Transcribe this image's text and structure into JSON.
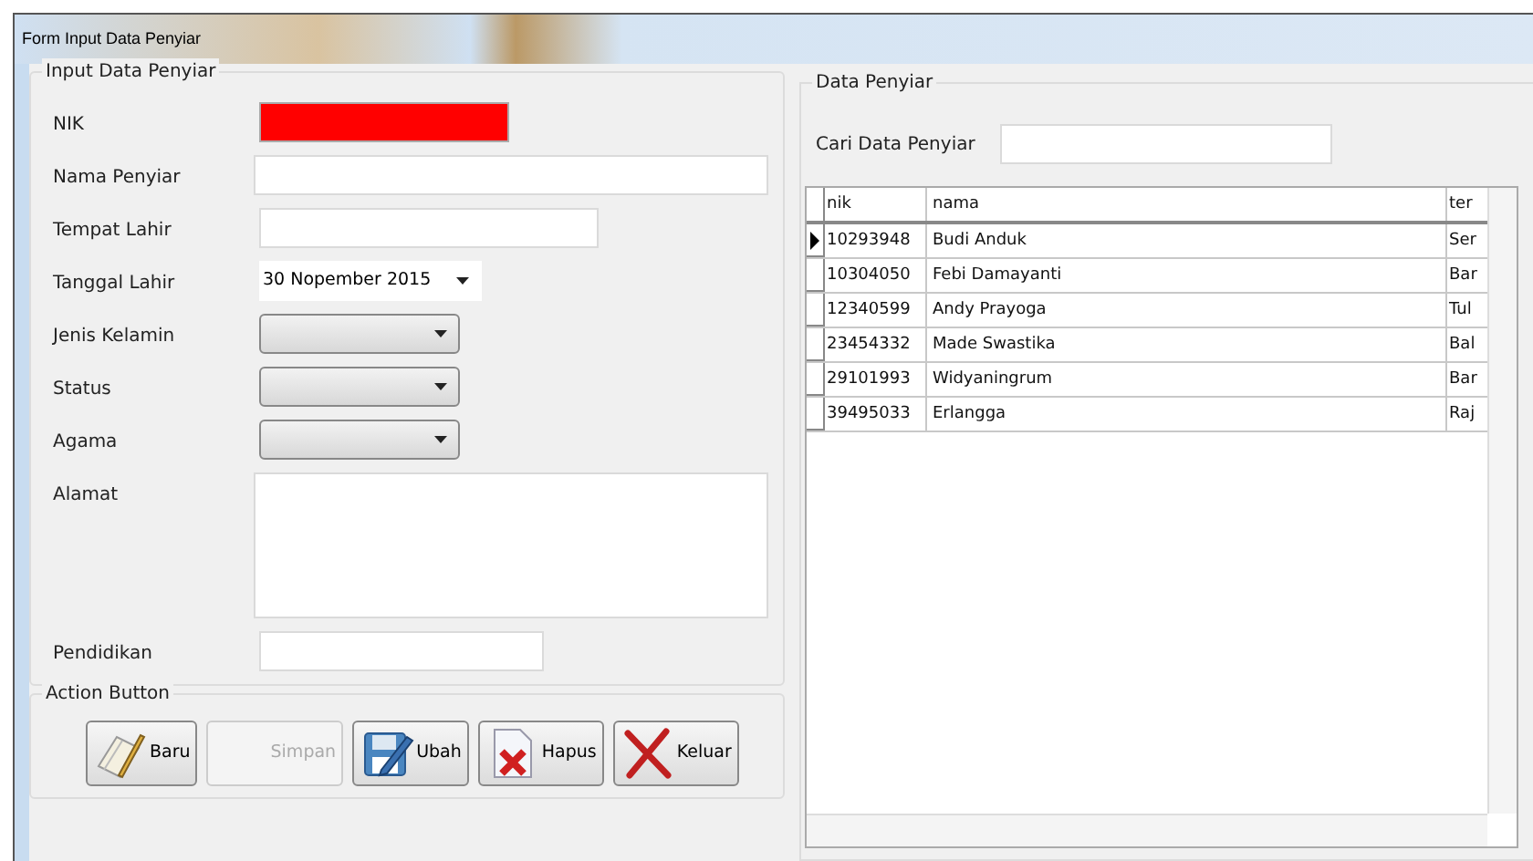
{
  "window": {
    "title": "Form Input Data Penyiar"
  },
  "input_group": {
    "title": "Input Data Penyiar",
    "fields": [
      {
        "kind": "text",
        "label": "NIK",
        "invalid": true
      },
      {
        "kind": "text",
        "label": "Nama Penyiar",
        "invalid": false
      },
      {
        "kind": "text",
        "label": "Tempat Lahir",
        "invalid": false
      },
      {
        "kind": "date",
        "label": "Tanggal Lahir",
        "value": "30 Nopember 2015"
      },
      {
        "kind": "combo",
        "label": "Jenis Kelamin"
      },
      {
        "kind": "combo",
        "label": "Status"
      },
      {
        "kind": "combo",
        "label": "Agama"
      },
      {
        "kind": "textarea",
        "label": "Alamat"
      },
      {
        "kind": "text",
        "label": "Pendidikan",
        "invalid": false
      }
    ]
  },
  "action_group": {
    "title": "Action Button",
    "buttons": [
      {
        "kind": "new",
        "label": "Baru",
        "disabled": false
      },
      {
        "kind": "save",
        "label": "Simpan",
        "disabled": true
      },
      {
        "kind": "edit",
        "label": "Ubah",
        "disabled": false
      },
      {
        "kind": "delete",
        "label": "Hapus",
        "disabled": false
      },
      {
        "kind": "exit",
        "label": "Keluar",
        "disabled": false
      }
    ]
  },
  "data_group": {
    "title": "Data Penyiar",
    "search_label": "Cari Data Penyiar",
    "table": {
      "columns": [
        "nik",
        "nama",
        "ter"
      ],
      "rows": [
        {
          "selected": true,
          "cells": [
            "10293948",
            "Budi Anduk",
            "Ser"
          ]
        },
        {
          "selected": false,
          "cells": [
            "10304050",
            "Febi Damayanti",
            "Bar"
          ]
        },
        {
          "selected": false,
          "cells": [
            "12340599",
            "Andy Prayoga",
            "Tul"
          ]
        },
        {
          "selected": false,
          "cells": [
            "23454332",
            "Made Swastika",
            "Bal"
          ]
        },
        {
          "selected": false,
          "cells": [
            "29101993",
            "Widyaningrum",
            "Bar"
          ]
        },
        {
          "selected": false,
          "cells": [
            "39495033",
            "Erlangga",
            "Raj"
          ]
        }
      ]
    }
  }
}
